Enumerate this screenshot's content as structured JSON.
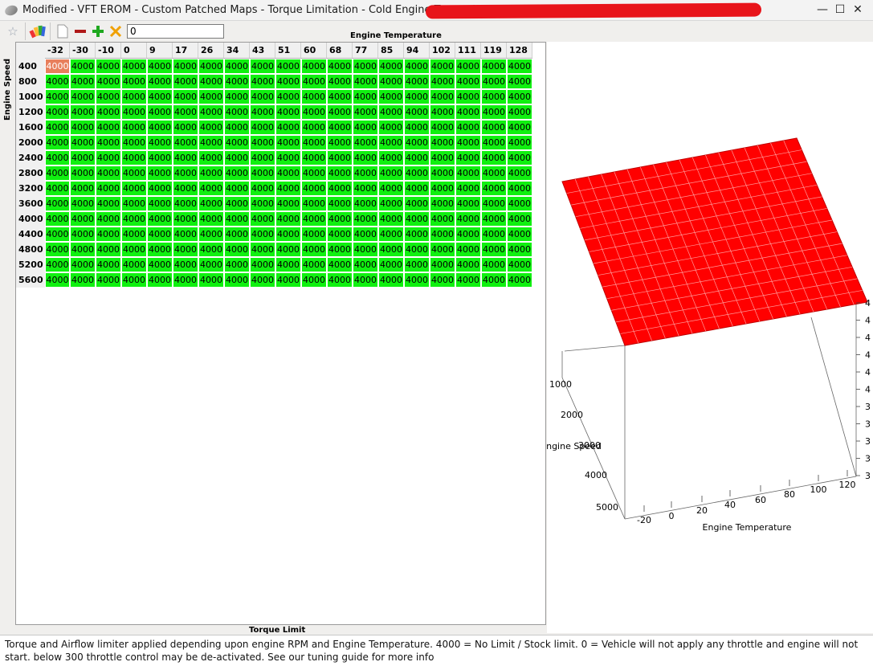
{
  "window": {
    "title": "Modified - VFT EROM - Custom Patched Maps - Torque Limitation - Cold Engine Torque Limiter",
    "buttons": [
      "—",
      "☐",
      "✕"
    ]
  },
  "toolbar": {
    "input_value": "0",
    "icons": [
      "star-icon",
      "palette-icon",
      "page-icon",
      "remove-icon",
      "add-icon",
      "clear-icon"
    ]
  },
  "table": {
    "column_axis_label": "Engine Temperature",
    "row_axis_label": "Engine Speed",
    "bottom_label": "Torque Limit",
    "columns": [
      "-32",
      "-30",
      "-10",
      "0",
      "9",
      "17",
      "26",
      "34",
      "43",
      "51",
      "60",
      "68",
      "77",
      "85",
      "94",
      "102",
      "111",
      "119",
      "128"
    ],
    "rows": [
      "400",
      "800",
      "1000",
      "1200",
      "1600",
      "2000",
      "2400",
      "2800",
      "3200",
      "3600",
      "4000",
      "4400",
      "4800",
      "5200",
      "5600"
    ],
    "cell_value": "4000",
    "selected_cell": {
      "row": 0,
      "col": 0
    },
    "colors": {
      "cell": "#10f010",
      "selected": "#e87f5c"
    }
  },
  "chart": {
    "x_label": "Engine Temperature",
    "y_label": "Engine Speed",
    "x_ticks": [
      "-20",
      "0",
      "20",
      "40",
      "60",
      "80",
      "100",
      "120"
    ],
    "y_ticks": [
      "1000",
      "2000",
      "3000",
      "4000",
      "5000"
    ],
    "z_ticks": [
      "4",
      "4",
      "4",
      "4",
      "4",
      "4",
      "3",
      "3",
      "3",
      "3",
      "3"
    ],
    "surface_color": "#ff0000"
  },
  "status": {
    "text": "Torque and Airflow limiter applied depending upon engine RPM and Engine Temperature. 4000 = No Limit / Stock limit. 0 = Vehicle will not apply any throttle and engine will not start. below 300 throttle control may be de-activated. See our tuning guide for more info"
  }
}
